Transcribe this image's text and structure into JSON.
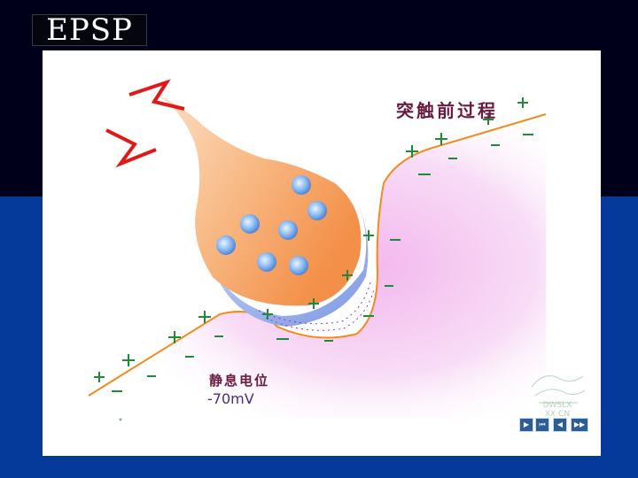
{
  "slide": {
    "title": "EPSP"
  },
  "diagram": {
    "label_presynaptic": "突触前过程",
    "label_resting": "静息电位",
    "label_potential": "-70mV"
  },
  "watermark": {
    "line1": "DWSLX",
    "line2": "XX·CN"
  },
  "nav": {
    "first": "▶",
    "prev_end": "⏮",
    "prev": "◀",
    "next": "▶▶"
  },
  "colors": {
    "terminal_orange": "#f6a366",
    "membrane_line": "#f08c1e",
    "charge_green": "#1f8a3a",
    "postsynaptic_pink": "#f4c6f0",
    "vesicle_blue": "#6ea6ee",
    "lightning_red": "#e01818"
  }
}
